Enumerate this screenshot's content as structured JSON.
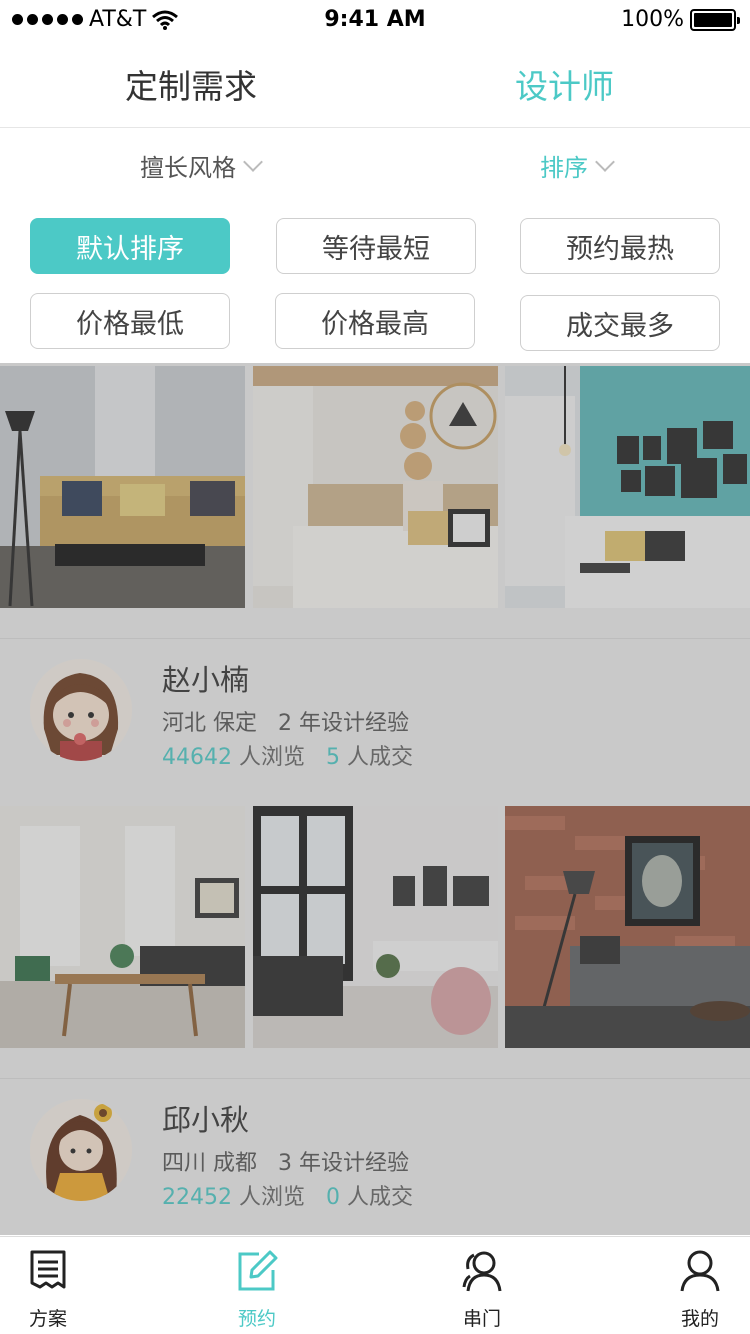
{
  "status_bar": {
    "carrier": "AT&T",
    "time": "9:41 AM",
    "battery": "100%"
  },
  "top_tabs": [
    {
      "label": "定制需求"
    },
    {
      "label": "设计师"
    }
  ],
  "filters": [
    {
      "label": "擅长风格"
    },
    {
      "label": "排序"
    }
  ],
  "sort_options": [
    {
      "label": "默认排序",
      "active": true
    },
    {
      "label": "等待最短"
    },
    {
      "label": "预约最热"
    },
    {
      "label": "价格最低"
    },
    {
      "label": "价格最高"
    },
    {
      "label": "成交最多"
    }
  ],
  "designers": [
    {
      "name": "赵小楠",
      "location": "河北 保定",
      "experience": "2 年设计经验",
      "views": "44642",
      "views_label": "人浏览",
      "deals": "5",
      "deals_label": "人成交"
    },
    {
      "name": "邱小秋",
      "location": "四川 成都",
      "experience": "3 年设计经验",
      "views": "22452",
      "views_label": "人浏览",
      "deals": "0",
      "deals_label": "人成交"
    }
  ],
  "tab_bar": [
    {
      "label": "方案",
      "icon": "document-icon"
    },
    {
      "label": "预约",
      "icon": "edit-icon"
    },
    {
      "label": "串门",
      "icon": "people-icon"
    },
    {
      "label": "我的",
      "icon": "user-icon"
    }
  ],
  "colors": {
    "accent": "#4cc9c6",
    "text": "#333333"
  }
}
